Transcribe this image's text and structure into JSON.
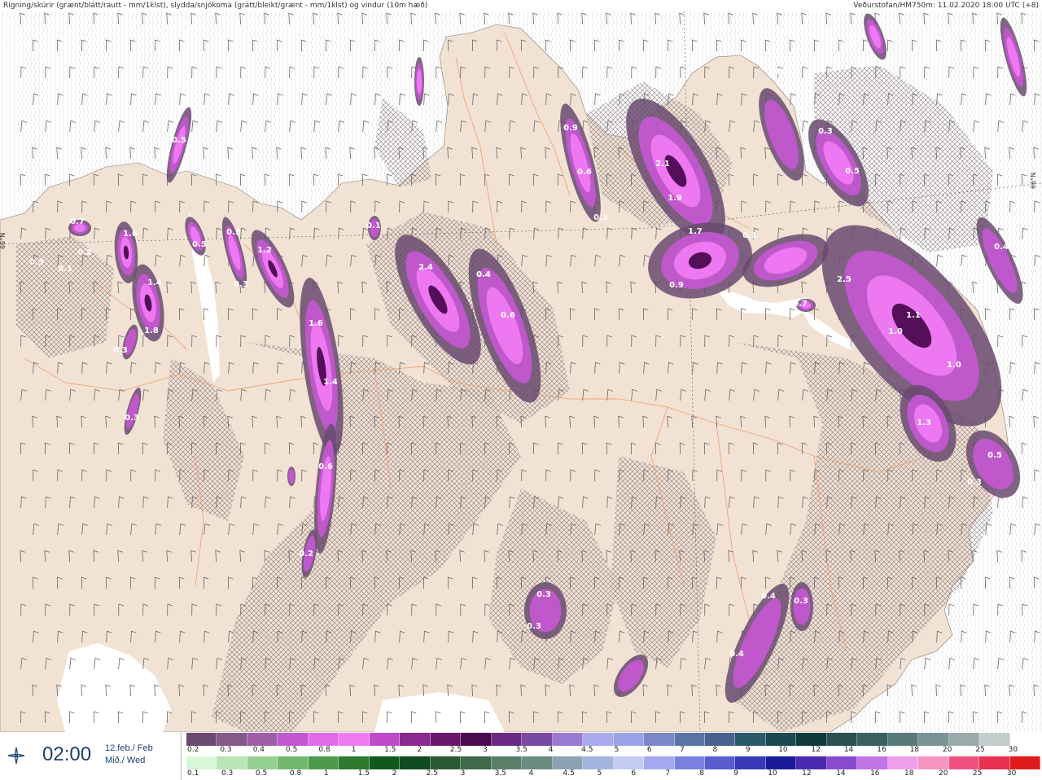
{
  "header": {
    "title_left": "Rigning/skúrir (grænt/blátt/rautt - mm/1klst), slydda/snjókoma (grátt/bleikt/grænt - mm/1klst) og vindur (10m hæð)",
    "title_right": "Veðurstofan/HM750m: 11.02.2020 18:00 UTC (+8)"
  },
  "map": {
    "lat_labels": [
      "66°N",
      "66°N"
    ],
    "colors": {
      "land": "#f1e2d4",
      "sea": "#ffffff",
      "roads": "#f0a070",
      "barb": "#666666",
      "snow_light": "#6a4a70",
      "snow_mid": "#c257d0",
      "snow_high": "#f07af2",
      "snow_peak": "#4a0a4e"
    },
    "precip_labels": [
      "0.5",
      "0.7",
      "1.6",
      "0.2",
      "0.3",
      "0.1",
      "1.4",
      "0.5",
      "0.5",
      "1.2",
      "0.3",
      "1.8",
      "0.3",
      "1.6",
      "1.4",
      "0.6",
      "0.2",
      "0.3",
      "2.4",
      "0.4",
      "0.6",
      "0.9",
      "0.6",
      "0.3",
      "2.1",
      "1.9",
      "1.7",
      "0.1",
      "0.9",
      "0.4",
      "0.4",
      "0.3",
      "0.5",
      "2.5",
      "1.1",
      "1.0",
      "1.0",
      "1.3",
      "0.5",
      "0.3",
      "0.1",
      "0.4",
      "0.7",
      "0.4",
      "0.3",
      "0.4",
      "0.3",
      "0.3"
    ]
  },
  "timebox": {
    "time": "02:00",
    "date_line1": "12.feb./ Feb",
    "date_line2": "Mið./ Wed",
    "logo_icon": "weather-office-logo-icon"
  },
  "legend_top": {
    "colors": [
      "#6a4a70",
      "#855a8a",
      "#a05ea8",
      "#c257d0",
      "#e26ce8",
      "#f07af2",
      "#c04ac8",
      "#8a2a8e",
      "#6a186e",
      "#4a0a4e",
      "#6a2a82",
      "#7a4aa2",
      "#9a7ad2",
      "#aaaaee",
      "#9aa2e8",
      "#7a88c8",
      "#5a74a8",
      "#4a6090",
      "#2a5a6a",
      "#1a4a50",
      "#0e3a3a",
      "#2a5050",
      "#3a6060",
      "#5a7a7a",
      "#7a9494",
      "#9aaaaa",
      "#c4cccc",
      "#ffffff"
    ],
    "ticks": [
      "0.2",
      "0.3",
      "0.4",
      "0.5",
      "0.8",
      "1",
      "1.5",
      "2",
      "2.5",
      "3",
      "3.5",
      "4",
      "4.5",
      "5",
      "6",
      "7",
      "8",
      "9",
      "10",
      "12",
      "14",
      "16",
      "18",
      "20",
      "25",
      "30"
    ]
  },
  "legend_bottom": {
    "colors": [
      "#d8f6d8",
      "#b8e6b4",
      "#94d090",
      "#74b870",
      "#4e9a4c",
      "#2e7a2e",
      "#0e5a1a",
      "#104a20",
      "#2a5a34",
      "#3e6a4a",
      "#5a7e6a",
      "#6a8c82",
      "#8aa2b2",
      "#a2b4dc",
      "#c4ccf4",
      "#a4aaf0",
      "#7a80e0",
      "#5a5cd0",
      "#3a3ab8",
      "#1a1a9a",
      "#4a2ab0",
      "#8a4ad0",
      "#c274e4",
      "#f0a0ea",
      "#f494c0",
      "#f05080",
      "#e83050",
      "#e01a1a"
    ],
    "ticks": [
      "0.1",
      "0.3",
      "0.5",
      "0.8",
      "1",
      "1.5",
      "2",
      "2.5",
      "3",
      "3.5",
      "4",
      "4.5",
      "5",
      "6",
      "7",
      "8",
      "9",
      "10",
      "12",
      "14",
      "16",
      "18",
      "20",
      "25",
      "30"
    ]
  }
}
